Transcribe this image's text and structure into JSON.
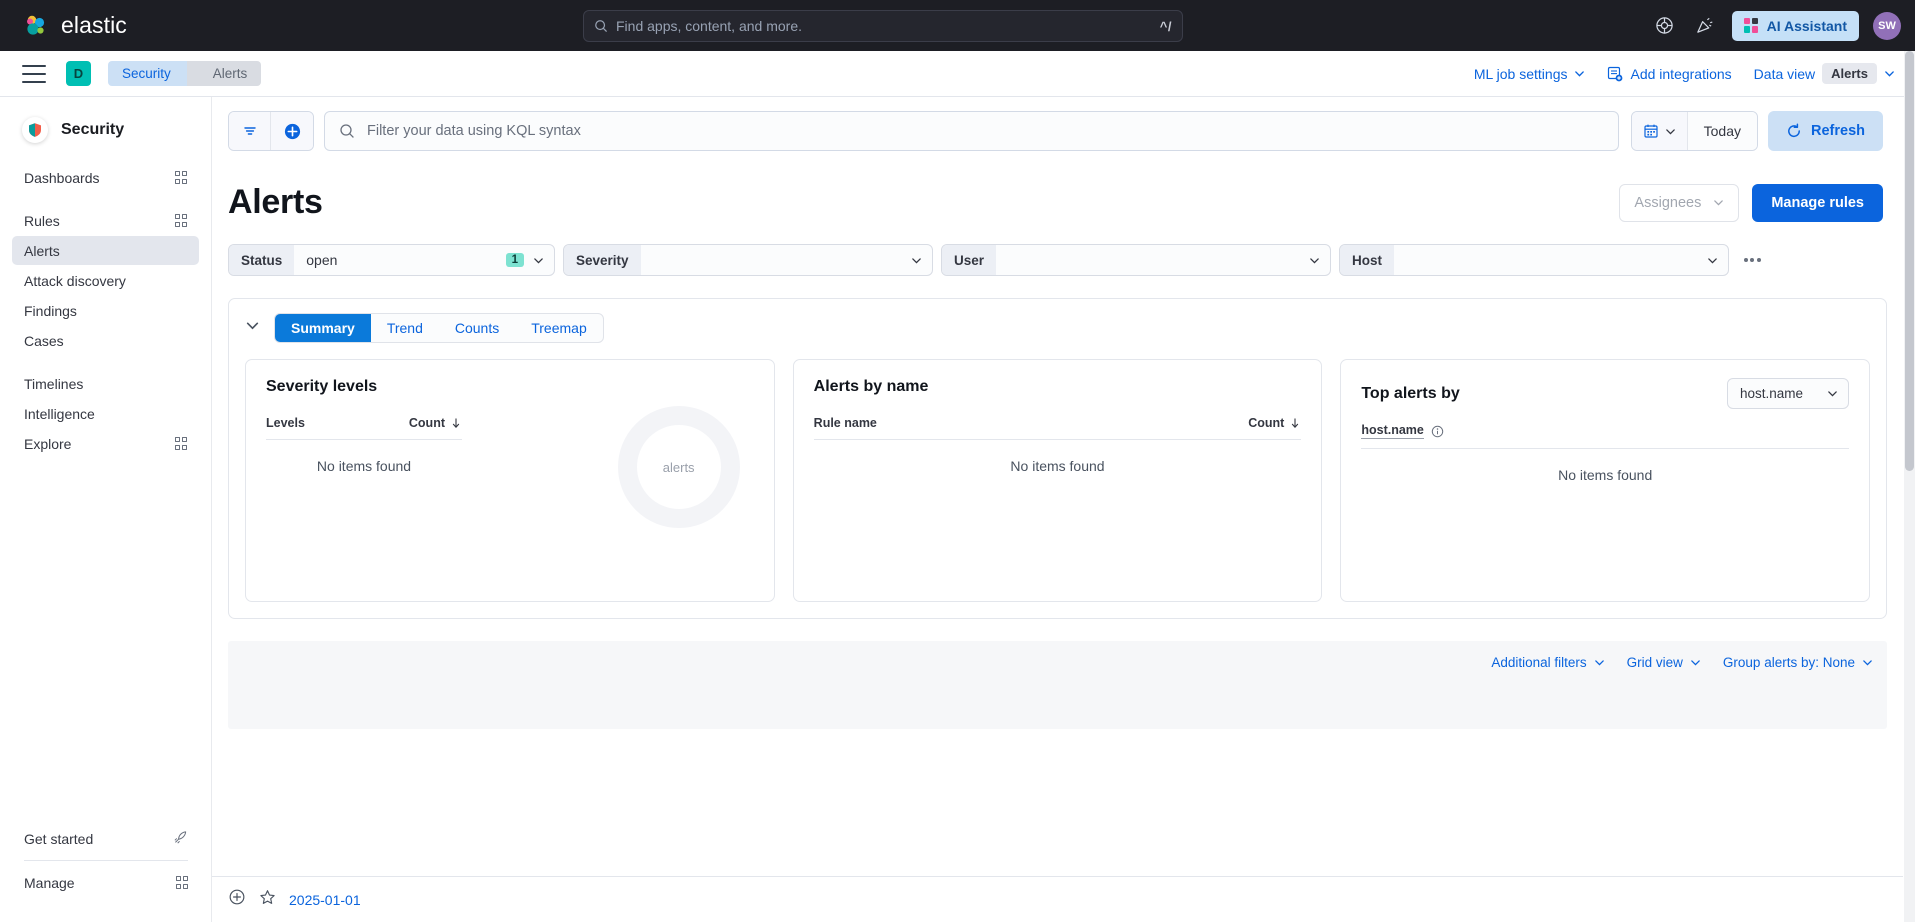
{
  "topbar": {
    "brand": "elastic",
    "search_placeholder": "Find apps, content, and more.",
    "search_shortcut": "^/",
    "help_icon": "help-circle-icon",
    "announce_icon": "megaphone-icon",
    "ai_assistant_label": "AI Assistant",
    "user_initials": "SW"
  },
  "header": {
    "space_initial": "D",
    "breadcrumbs": [
      "Security",
      "Alerts"
    ],
    "ml_job_settings": "ML job settings",
    "add_integrations": "Add integrations",
    "data_view_label": "Data view",
    "data_view_value": "Alerts"
  },
  "sidebar": {
    "title": "Security",
    "items": [
      {
        "label": "Dashboards",
        "icon": "grid-icon",
        "selected": false
      },
      {
        "label": "Rules",
        "icon": "grid-icon",
        "selected": false
      },
      {
        "label": "Alerts",
        "icon": "",
        "selected": true
      },
      {
        "label": "Attack discovery",
        "icon": "",
        "selected": false
      },
      {
        "label": "Findings",
        "icon": "",
        "selected": false
      },
      {
        "label": "Cases",
        "icon": "",
        "selected": false
      },
      {
        "label": "Timelines",
        "icon": "",
        "selected": false
      },
      {
        "label": "Intelligence",
        "icon": "",
        "selected": false
      },
      {
        "label": "Explore",
        "icon": "grid-icon",
        "selected": false
      }
    ],
    "bottom_items": [
      {
        "label": "Get started",
        "icon": "rocket-icon"
      },
      {
        "label": "Manage",
        "icon": "grid-icon"
      }
    ]
  },
  "querybar": {
    "filter_icon": "filter-icon",
    "add_filter_icon": "add-circle-icon",
    "kql_placeholder": "Filter your data using KQL syntax",
    "date_icon": "calendar-icon",
    "date_value": "Today",
    "refresh_label": "Refresh"
  },
  "page": {
    "title": "Alerts",
    "assignees_label": "Assignees",
    "manage_rules_label": "Manage rules"
  },
  "filters": [
    {
      "label": "Status",
      "value": "open",
      "count": "1"
    },
    {
      "label": "Severity",
      "value": "",
      "count": ""
    },
    {
      "label": "User",
      "value": "",
      "count": ""
    },
    {
      "label": "Host",
      "value": "",
      "count": ""
    }
  ],
  "tabs": [
    {
      "label": "Summary",
      "active": true
    },
    {
      "label": "Trend",
      "active": false
    },
    {
      "label": "Counts",
      "active": false
    },
    {
      "label": "Treemap",
      "active": false
    }
  ],
  "cards": {
    "severity": {
      "title": "Severity levels",
      "col_levels": "Levels",
      "col_count": "Count",
      "empty": "No items found",
      "donut_label": "alerts"
    },
    "by_name": {
      "title": "Alerts by name",
      "col_rule": "Rule name",
      "col_count": "Count",
      "empty": "No items found"
    },
    "top_alerts": {
      "title": "Top alerts by",
      "select_value": "host.name",
      "col_field": "host.name",
      "info_icon": "info-circle-icon",
      "empty": "No items found"
    }
  },
  "grid_controls": {
    "additional_filters": "Additional filters",
    "grid_view": "Grid view",
    "group_alerts_by": "Group alerts by: None"
  },
  "bottombar": {
    "add_icon": "add-circle-icon",
    "star_icon": "star-icon",
    "date": "2025-01-01"
  },
  "colors": {
    "brand_dark": "#1d1e24",
    "primary_blue": "#0b64dd",
    "accent_teal": "#00bfb3",
    "badge_teal": "#7de2d1",
    "tab_blue": "#0b7ada"
  }
}
